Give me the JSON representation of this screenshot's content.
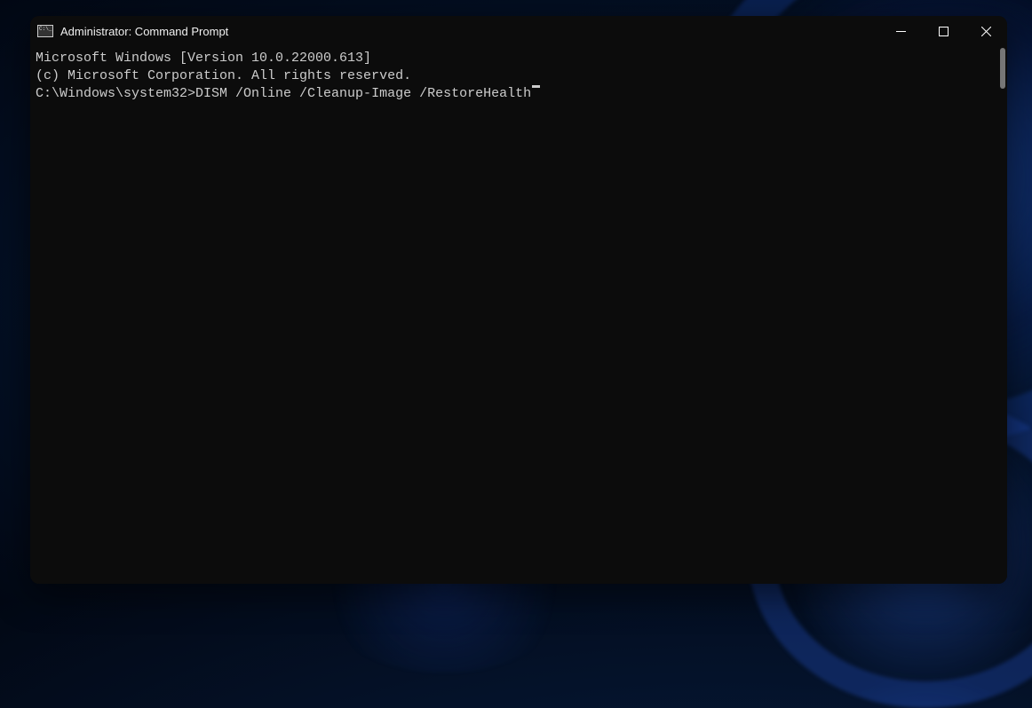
{
  "window": {
    "title": "Administrator: Command Prompt"
  },
  "terminal": {
    "line1": "Microsoft Windows [Version 10.0.22000.613]",
    "line2": "(c) Microsoft Corporation. All rights reserved.",
    "blank": "",
    "prompt": "C:\\Windows\\system32>",
    "command": "DISM /Online /Cleanup-Image /RestoreHealth"
  }
}
